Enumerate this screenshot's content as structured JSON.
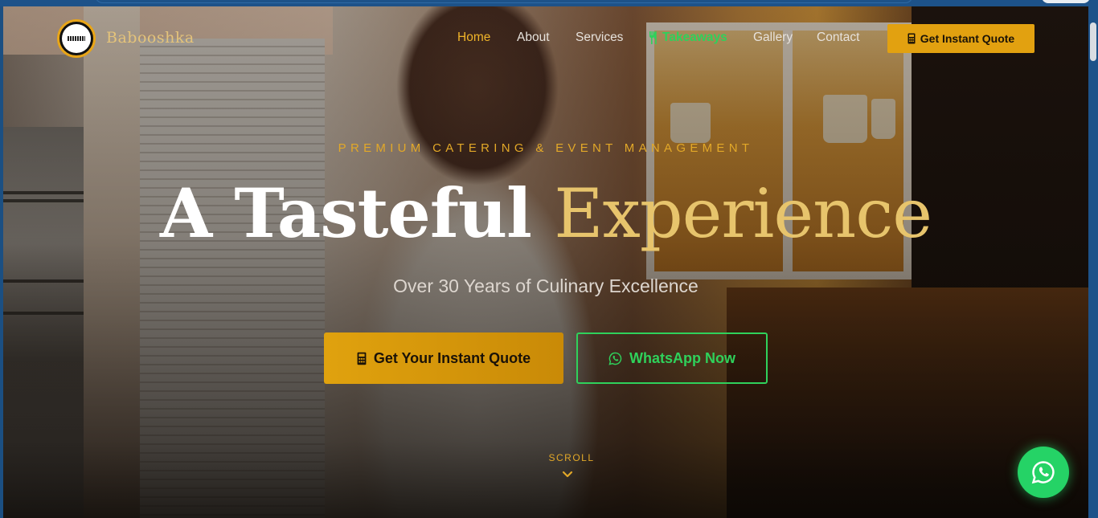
{
  "nav": {
    "brand": "Babooshka",
    "logo_icon": "babooshka-logo",
    "items": [
      {
        "label": "Home",
        "active": true
      },
      {
        "label": "About"
      },
      {
        "label": "Services"
      },
      {
        "label": "Takeaways",
        "icon": "utensils-icon",
        "highlight": "#2fd15b"
      },
      {
        "label": "Gallery"
      },
      {
        "label": "Contact"
      }
    ],
    "cta_label": "Get Instant Quote",
    "cta_icon": "calculator-icon"
  },
  "hero": {
    "eyebrow": "PREMIUM CATERING & EVENT MANAGEMENT",
    "headline_white": "A Tasteful",
    "headline_gold": "Experience",
    "subtitle": "Over 30 Years of Culinary Excellence",
    "primary_button": "Get Your Instant Quote",
    "secondary_button": "WhatsApp Now",
    "scroll_label": "SCROLL"
  },
  "colors": {
    "gold": "#e2a110",
    "gold_text": "#e7c46c",
    "whatsapp_green": "#25d366",
    "frame_blue": "#1d5289"
  }
}
